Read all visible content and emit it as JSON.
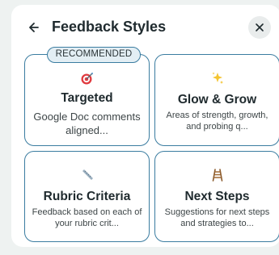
{
  "dialog": {
    "title": "Feedback Styles",
    "back_icon": "arrow-left-icon",
    "close_icon": "close-icon"
  },
  "badge": {
    "label": "RECOMMENDED"
  },
  "styles": [
    {
      "icon": "target-icon",
      "icon_glyph": "🎯",
      "title": "Targeted",
      "description": "Google Doc comments aligned..."
    },
    {
      "icon": "sparkles-icon",
      "icon_glyph": "✨",
      "title": "Glow & Grow",
      "description": "Areas of strength, growth, and probing q..."
    },
    {
      "icon": "ruler-icon",
      "icon_glyph": "📏",
      "title": "Rubric Criteria",
      "description": "Feedback based on each of your rubric crit..."
    },
    {
      "icon": "ladder-icon",
      "icon_glyph": "🪜",
      "title": "Next Steps",
      "description": "Suggestions for next steps and strategies to..."
    }
  ],
  "colors": {
    "card_border": "#3a7ca0",
    "badge_bg": "#e3eef4",
    "background": "#eef2f1"
  }
}
